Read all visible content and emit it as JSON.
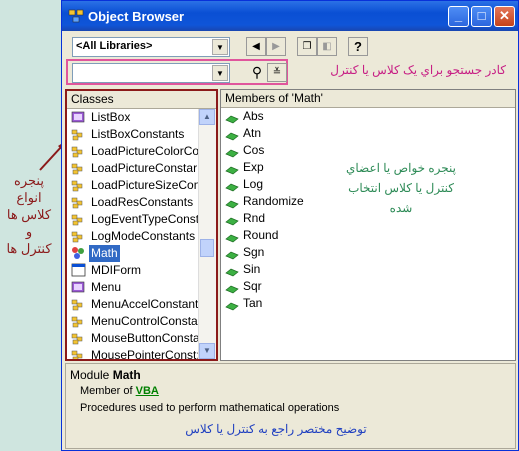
{
  "window": {
    "title": "Object Browser"
  },
  "toolbar": {
    "library_value": "<All Libraries>",
    "search_value": "",
    "help_label": "?"
  },
  "annotations": {
    "search_box": "کادر جستجو براي يک کلاس يا کنترل",
    "left_panel": [
      "پنجره",
      "انواع",
      "کلاس ها",
      "و",
      "کنترل ها"
    ],
    "members_panel": [
      "پنجره خواص يا اعضاي",
      "کنترل يا کلاس انتخاب",
      "شده"
    ],
    "description": "توضيح مختصر راجع به کنترل يا کلاس"
  },
  "classes": {
    "header": "Classes",
    "items": [
      {
        "label": "ListBox",
        "icon": "control-icon"
      },
      {
        "label": "ListBoxConstants",
        "icon": "enum-icon"
      },
      {
        "label": "LoadPictureColorCo",
        "icon": "enum-icon"
      },
      {
        "label": "LoadPictureConstar",
        "icon": "enum-icon"
      },
      {
        "label": "LoadPictureSizeCon",
        "icon": "enum-icon"
      },
      {
        "label": "LoadResConstants",
        "icon": "enum-icon"
      },
      {
        "label": "LogEventTypeConst",
        "icon": "enum-icon"
      },
      {
        "label": "LogModeConstants",
        "icon": "enum-icon"
      },
      {
        "label": "Math",
        "icon": "module-icon",
        "selected": true
      },
      {
        "label": "MDIForm",
        "icon": "form-icon"
      },
      {
        "label": "Menu",
        "icon": "control-icon"
      },
      {
        "label": "MenuAccelConstants",
        "icon": "enum-icon"
      },
      {
        "label": "MenuControlConsta",
        "icon": "enum-icon"
      },
      {
        "label": "MouseButtonConsta",
        "icon": "enum-icon"
      },
      {
        "label": "MousePointerConst:",
        "icon": "enum-icon"
      }
    ]
  },
  "members": {
    "header": "Members of 'Math'",
    "items": [
      "Abs",
      "Atn",
      "Cos",
      "Exp",
      "Log",
      "Randomize",
      "Rnd",
      "Round",
      "Sgn",
      "Sin",
      "Sqr",
      "Tan"
    ]
  },
  "details": {
    "module_prefix": "Module",
    "module_name": "Math",
    "member_of_prefix": "Member of",
    "member_of_link": "VBA",
    "description": "Procedures used to perform mathematical operations"
  },
  "colors": {
    "title_bar": "#0a4fd4",
    "selection": "#316ac5",
    "highlight_border": "#e0559c",
    "panel_border": "#8b1a1a"
  }
}
